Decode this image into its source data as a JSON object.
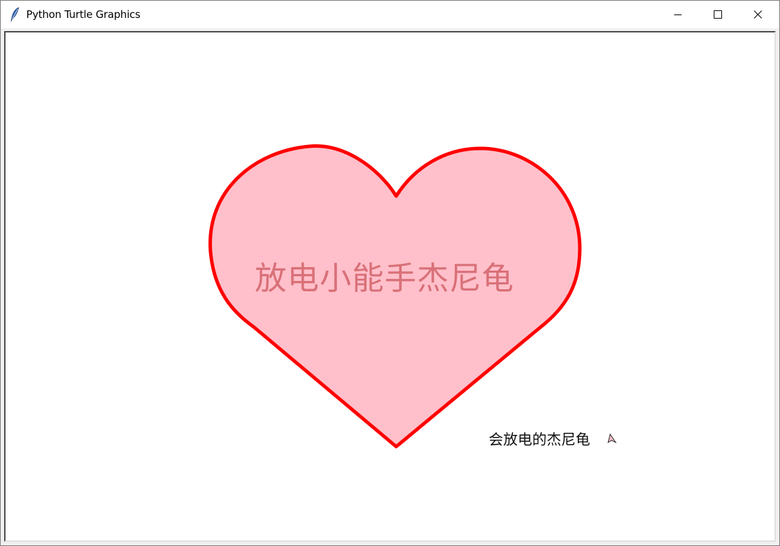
{
  "window": {
    "title": "Python Turtle Graphics",
    "icon": "feather-icon",
    "controls": {
      "minimize": "minimize-icon",
      "maximize": "maximize-icon",
      "close": "close-icon"
    }
  },
  "canvas": {
    "background": "#ffffff",
    "heart": {
      "fill_color": "#ffc0cb",
      "outline_color": "#ff0000",
      "label": "放电小能手杰尼龟",
      "label_color": "#d97078"
    },
    "signature": "会放电的杰尼龟",
    "turtle_cursor": "turtle-arrow-icon"
  }
}
